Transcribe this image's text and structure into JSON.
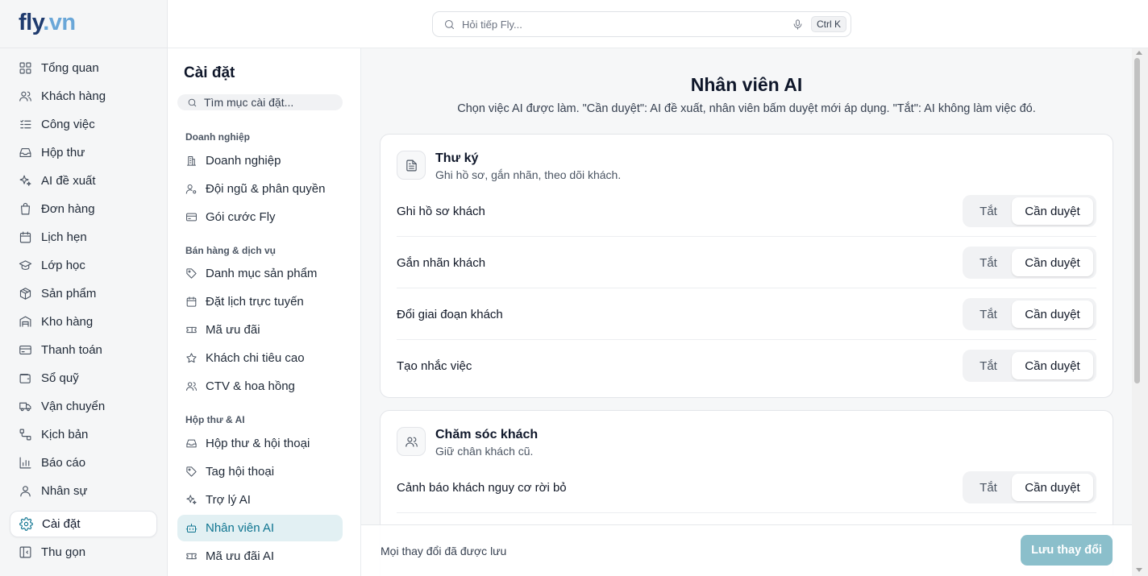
{
  "brand": {
    "name": "fly",
    "dot": ".",
    "tld": "vn"
  },
  "search": {
    "placeholder": "Hỏi tiếp Fly...",
    "shortcut": "Ctrl K"
  },
  "sidebar": {
    "items": [
      {
        "label": "Tổng quan",
        "icon": "grid-icon"
      },
      {
        "label": "Khách hàng",
        "icon": "users-icon"
      },
      {
        "label": "Công việc",
        "icon": "task-list-icon"
      },
      {
        "label": "Hộp thư",
        "icon": "inbox-icon"
      },
      {
        "label": "AI đề xuất",
        "icon": "sparkles-icon"
      },
      {
        "label": "Đơn hàng",
        "icon": "shopping-bag-icon"
      },
      {
        "label": "Lịch hẹn",
        "icon": "calendar-icon"
      },
      {
        "label": "Lớp học",
        "icon": "graduation-cap-icon"
      },
      {
        "label": "Sản phẩm",
        "icon": "package-icon"
      },
      {
        "label": "Kho hàng",
        "icon": "warehouse-icon"
      },
      {
        "label": "Thanh toán",
        "icon": "credit-card-icon"
      },
      {
        "label": "Sổ quỹ",
        "icon": "wallet-icon"
      },
      {
        "label": "Vận chuyển",
        "icon": "truck-icon"
      },
      {
        "label": "Kịch bản",
        "icon": "workflow-icon"
      },
      {
        "label": "Báo cáo",
        "icon": "bar-chart-icon"
      },
      {
        "label": "Nhân sự",
        "icon": "user-icon"
      }
    ],
    "settings_label": "Cài đặt",
    "collapse_label": "Thu gọn"
  },
  "settings": {
    "title": "Cài đặt",
    "search_placeholder": "Tìm mục cài đặt...",
    "groups": [
      {
        "label": "Doanh nghiệp",
        "items": [
          {
            "label": "Doanh nghiệp",
            "icon": "building-icon"
          },
          {
            "label": "Đội ngũ & phân quyền",
            "icon": "user-cog-icon"
          },
          {
            "label": "Gói cước Fly",
            "icon": "credit-card-icon"
          }
        ]
      },
      {
        "label": "Bán hàng & dịch vụ",
        "items": [
          {
            "label": "Danh mục sản phẩm",
            "icon": "tag-icon"
          },
          {
            "label": "Đặt lịch trực tuyến",
            "icon": "calendar-icon"
          },
          {
            "label": "Mã ưu đãi",
            "icon": "ticket-icon"
          },
          {
            "label": "Khách chi tiêu cao",
            "icon": "star-icon"
          },
          {
            "label": "CTV & hoa hồng",
            "icon": "users-icon"
          }
        ]
      },
      {
        "label": "Hộp thư & AI",
        "items": [
          {
            "label": "Hộp thư & hội thoại",
            "icon": "inbox-icon"
          },
          {
            "label": "Tag hội thoại",
            "icon": "tag-icon"
          },
          {
            "label": "Trợ lý AI",
            "icon": "sparkles-icon"
          },
          {
            "label": "Nhân viên AI",
            "icon": "bot-icon",
            "active": true
          },
          {
            "label": "Mã ưu đãi AI",
            "icon": "ticket-icon"
          }
        ]
      }
    ]
  },
  "main": {
    "title": "Nhân viên AI",
    "description": "Chọn việc AI được làm. \"Cần duyệt\": AI đề xuất, nhân viên bấm duyệt mới áp dụng. \"Tắt\": AI không làm việc đó.",
    "option_off": "Tắt",
    "option_review": "Cần duyệt",
    "cards": [
      {
        "title": "Thư ký",
        "subtitle": "Ghi hồ sơ, gắn nhãn, theo dõi khách.",
        "icon": "document-icon",
        "rows": [
          {
            "label": "Ghi hồ sơ khách",
            "value": "Cần duyệt"
          },
          {
            "label": "Gắn nhãn khách",
            "value": "Cần duyệt"
          },
          {
            "label": "Đổi giai đoạn khách",
            "value": "Cần duyệt"
          },
          {
            "label": "Tạo nhắc việc",
            "value": "Cần duyệt"
          }
        ]
      },
      {
        "title": "Chăm sóc khách",
        "subtitle": "Giữ chân khách cũ.",
        "icon": "users-icon",
        "rows": [
          {
            "label": "Cảnh báo khách nguy cơ rời bỏ",
            "value": "Cần duyệt"
          }
        ]
      }
    ]
  },
  "footer": {
    "status": "Mọi thay đổi đã được lưu",
    "save_label": "Lưu thay đổi"
  },
  "colors": {
    "accent": "#0e7490",
    "accent_bg": "#e2f0f3",
    "save_button": "#8bbfcb",
    "brand_dark": "#1f3b6e",
    "brand_light": "#6aa7d8"
  }
}
